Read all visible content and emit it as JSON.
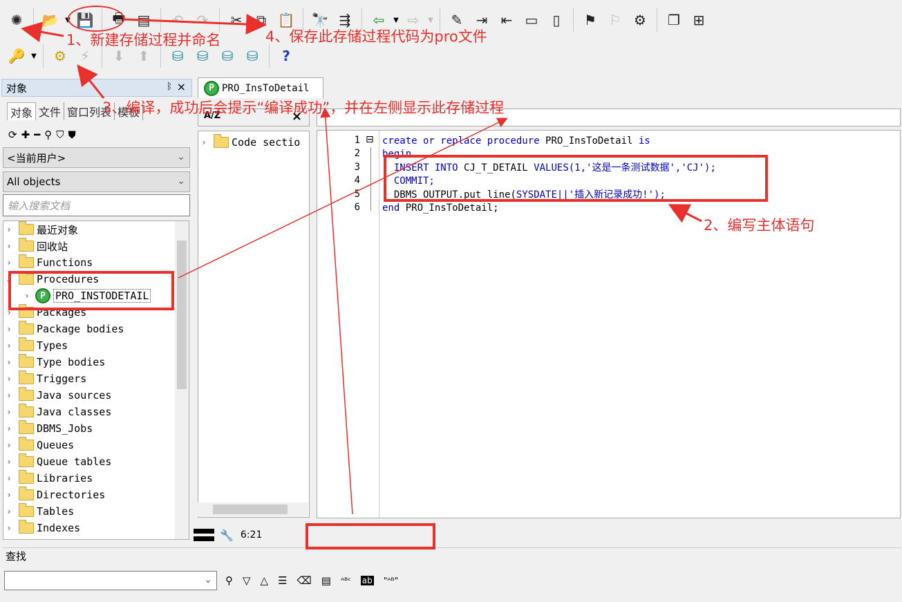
{
  "panel": {
    "title": "对象",
    "pin": "ᛒ",
    "close": "×"
  },
  "left_tabs": [
    "对象",
    "文件",
    "窗口列表",
    "模板"
  ],
  "user_combo": "<当前用户>",
  "objects_combo": "All objects",
  "search_placeholder": "输入搜索文档",
  "tree": {
    "items": [
      "最近对象",
      "回收站",
      "Functions",
      "Procedures",
      "PRO_INSTODETAIL",
      "Packages",
      "Package bodies",
      "Types",
      "Type bodies",
      "Triggers",
      "Java sources",
      "Java classes",
      "DBMS_Jobs",
      "Queues",
      "Queue tables",
      "Libraries",
      "Directories",
      "Tables",
      "Indexes"
    ]
  },
  "middle": {
    "sort_icon": "A/Z",
    "close": "×",
    "item": "Code sectio"
  },
  "editor": {
    "tab_title": "PRO_InsToDetail",
    "line_numbers": [
      "1",
      "2",
      "3",
      "4",
      "5",
      "6"
    ],
    "fold": "⊟",
    "lines": [
      {
        "kw1": "create or replace procedure ",
        "txt": "PRO_InsToDetail ",
        "kw2": "is"
      },
      {
        "kw1": "begin",
        "txt": "",
        "kw2": ""
      },
      {
        "kw1": "  INSERT INTO ",
        "txt": "CJ_T_DETAIL ",
        "kw2": "VALUES(1,'这是一条测试数据','CJ');"
      },
      {
        "kw1": "  COMMIT;",
        "txt": "",
        "kw2": ""
      },
      {
        "kw1": "",
        "txt": "  DBMS_OUTPUT.put_line(",
        "kw2": "SYSDATE||'插入新记录成功!');"
      },
      {
        "kw1": "end ",
        "txt": "PRO_InsToDetail;",
        "kw2": ""
      }
    ]
  },
  "status": {
    "position": "6:21"
  },
  "find": {
    "label": "查找"
  },
  "annotations": {
    "a1": "1、新建存储过程并命名",
    "a2": "2、编写主体语句",
    "a3": "3、编译，成功后会提示“编译成功”，并在左侧显示此存储过程",
    "a4": "4、保存此存储过程代码为pro文件"
  },
  "colors": {
    "annotation": "#e8302c",
    "keyword": "#0000c0",
    "panel_head": "#dbe5f1"
  }
}
